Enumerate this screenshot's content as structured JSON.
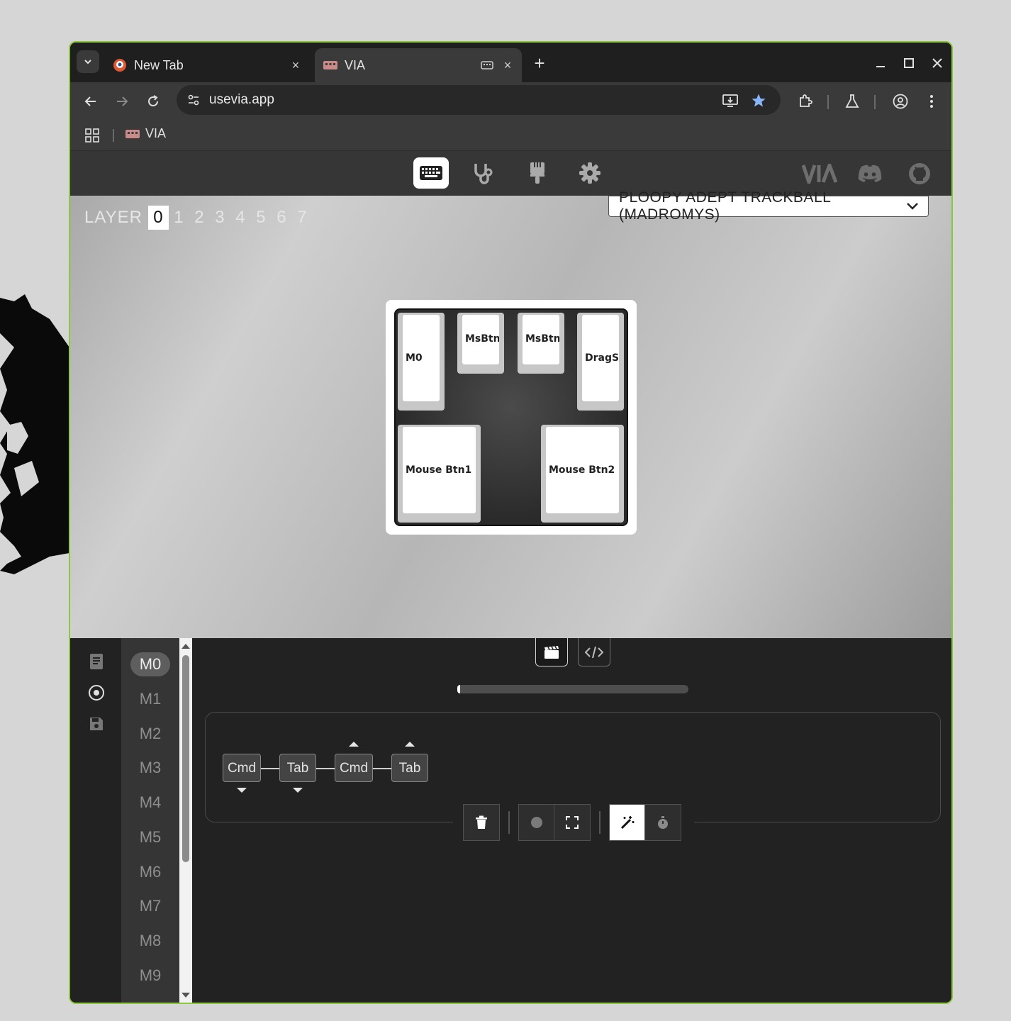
{
  "browser": {
    "tabs": [
      {
        "title": "New Tab",
        "close": "×"
      },
      {
        "title": "VIA",
        "close": "×"
      }
    ],
    "new_tab": "+",
    "url": "usevia.app",
    "bookmarks": [
      {
        "label": "VIA"
      }
    ]
  },
  "app": {
    "device_name": "PLOOPY ADEPT TRACKBALL (MADROMYS)",
    "layer_label": "LAYER",
    "layers": [
      "0",
      "1",
      "2",
      "3",
      "4",
      "5",
      "6",
      "7"
    ],
    "selected_layer": "0",
    "brand_text": "VIA",
    "keys": [
      "M0",
      "MsBtn",
      "MsBtn",
      "DragSc",
      "Mouse Btn1",
      "Mouse Btn2"
    ]
  },
  "macros": {
    "items": [
      "M0",
      "M1",
      "M2",
      "M3",
      "M4",
      "M5",
      "M6",
      "M7",
      "M8",
      "M9"
    ],
    "selected": "M0",
    "progress_fraction": 0.01,
    "sequence": [
      {
        "label": "Cmd",
        "direction": "down"
      },
      {
        "label": "Tab",
        "direction": "down"
      },
      {
        "label": "Cmd",
        "direction": "up"
      },
      {
        "label": "Tab",
        "direction": "up"
      }
    ]
  },
  "colors": {
    "window_border": "#8dc63f",
    "bookmark_star": "#8ab4f8"
  }
}
